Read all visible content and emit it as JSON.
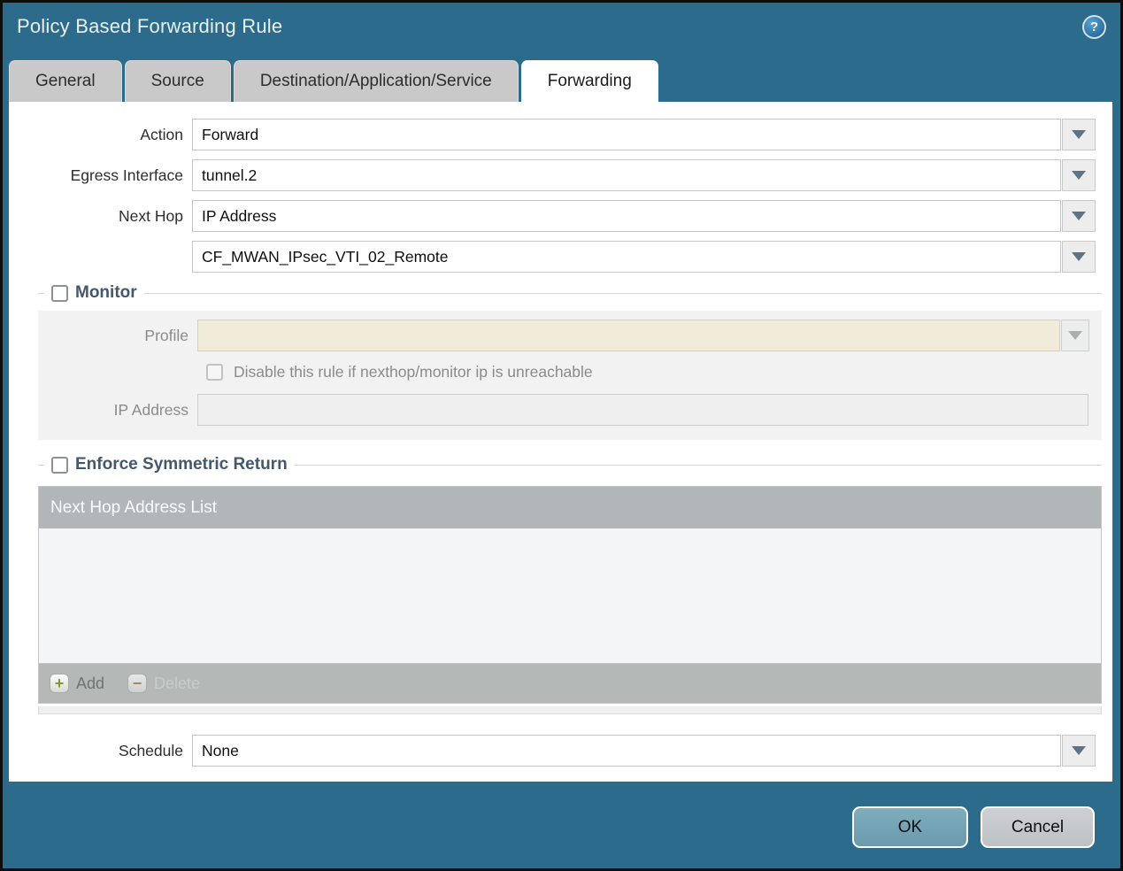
{
  "window": {
    "title": "Policy Based Forwarding Rule"
  },
  "help_icon": {
    "glyph": "?"
  },
  "tabs": [
    {
      "label": "General",
      "active": false
    },
    {
      "label": "Source",
      "active": false
    },
    {
      "label": "Destination/Application/Service",
      "active": false
    },
    {
      "label": "Forwarding",
      "active": true
    }
  ],
  "form": {
    "action": {
      "label": "Action",
      "value": "Forward"
    },
    "egress_interface": {
      "label": "Egress Interface",
      "value": "tunnel.2"
    },
    "next_hop": {
      "label": "Next Hop",
      "value": "IP Address"
    },
    "next_hop_address": {
      "value": "CF_MWAN_IPsec_VTI_02_Remote"
    },
    "schedule": {
      "label": "Schedule",
      "value": "None"
    }
  },
  "monitor": {
    "legend": "Monitor",
    "checked": false,
    "profile": {
      "label": "Profile",
      "value": ""
    },
    "disable_rule": {
      "label": "Disable this rule if nexthop/monitor ip is unreachable",
      "checked": false
    },
    "ip_address": {
      "label": "IP Address",
      "value": ""
    }
  },
  "symmetric_return": {
    "legend": "Enforce Symmetric Return",
    "checked": false,
    "table": {
      "header": "Next Hop Address List",
      "rows": []
    },
    "add_label": "Add",
    "delete_label": "Delete",
    "add_icon_glyph": "+",
    "delete_icon_glyph": "−"
  },
  "footer": {
    "ok_label": "OK",
    "cancel_label": "Cancel"
  },
  "colors": {
    "dialog_background": "#2d6b8c",
    "active_tab": "#ffffff",
    "inactive_tab": "#c9c9c9",
    "disabled_field_beige": "#f1ecd9",
    "table_header": "#b1b7b9",
    "ok_button": "#74a5b6",
    "cancel_button": "#c4c8ca",
    "legend_text": "#44576b",
    "add_icon_green": "#7c9c2e",
    "delete_icon_red": "#aa6a5b"
  }
}
